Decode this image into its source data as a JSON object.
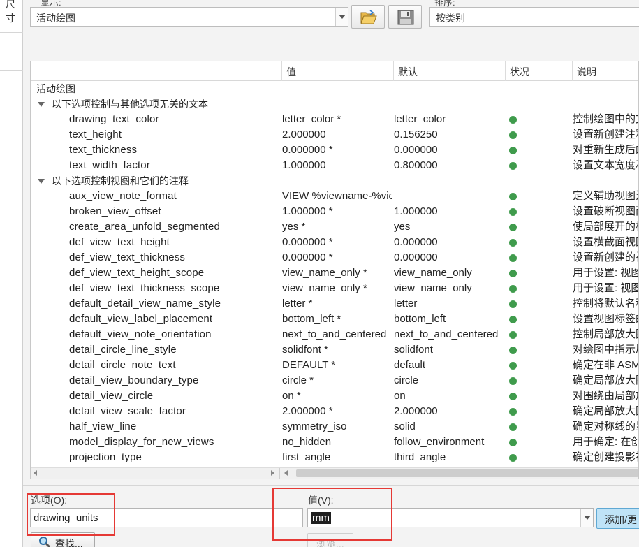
{
  "left_panel": {
    "label": "尺寸"
  },
  "header": {
    "show_label": "显示:",
    "show_value": "活动绘图",
    "sort_label": "排序:",
    "sort_value": "按类别",
    "open_icon": "folder-open-icon",
    "save_icon": "floppy-disk-icon"
  },
  "table": {
    "columns": [
      "",
      "值",
      "默认",
      "状况",
      "说明"
    ],
    "status_color": "#3f9b4c",
    "root_label": "活动绘图",
    "groups": [
      {
        "title": "以下选项控制与其他选项无关的文本",
        "rows": [
          {
            "name": "drawing_text_color",
            "value": "letter_color *",
            "default": "letter_color",
            "desc": "控制绘图中的文"
          },
          {
            "name": "text_height",
            "value": "2.000000",
            "default": "0.156250",
            "desc": "设置新创建注释"
          },
          {
            "name": "text_thickness",
            "value": "0.000000 *",
            "default": "0.000000",
            "desc": "对重新生成后的"
          },
          {
            "name": "text_width_factor",
            "value": "1.000000",
            "default": "0.800000",
            "desc": "设置文本宽度和"
          }
        ]
      },
      {
        "title": "以下选项控制视图和它们的注释",
        "rows": [
          {
            "name": "aux_view_note_format",
            "value": "VIEW %viewname-%viewname",
            "default": "",
            "desc": "定义辅助视图注"
          },
          {
            "name": "broken_view_offset",
            "value": "1.000000 *",
            "default": "1.000000",
            "desc": "设置破断视图两"
          },
          {
            "name": "create_area_unfold_segmented",
            "value": "yes *",
            "default": "yes",
            "desc": "使局部展开的横"
          },
          {
            "name": "def_view_text_height",
            "value": "0.000000 *",
            "default": "0.000000",
            "desc": "设置横截面视图"
          },
          {
            "name": "def_view_text_thickness",
            "value": "0.000000 *",
            "default": "0.000000",
            "desc": "设置新创建的视"
          },
          {
            "name": "def_view_text_height_scope",
            "value": "view_name_only *",
            "default": "view_name_only",
            "desc": "用于设置: 视图"
          },
          {
            "name": "def_view_text_thickness_scope",
            "value": "view_name_only *",
            "default": "view_name_only",
            "desc": "用于设置: 视图"
          },
          {
            "name": "default_detail_view_name_style",
            "value": "letter *",
            "default": "letter",
            "desc": "控制将默认名称"
          },
          {
            "name": "default_view_label_placement",
            "value": "bottom_left *",
            "default": "bottom_left",
            "desc": "设置视图标签的"
          },
          {
            "name": "default_view_note_orientation",
            "value": "next_to_and_centered",
            "default": "next_to_and_centered",
            "desc": "控制局部放大图"
          },
          {
            "name": "detail_circle_line_style",
            "value": "solidfont *",
            "default": "solidfont",
            "desc": "对绘图中指示局"
          },
          {
            "name": "detail_circle_note_text",
            "value": "DEFAULT *",
            "default": "default",
            "desc": "确定在非 ASME"
          },
          {
            "name": "detail_view_boundary_type",
            "value": "circle *",
            "default": "circle",
            "desc": "确定局部放大图"
          },
          {
            "name": "detail_view_circle",
            "value": "on *",
            "default": "on",
            "desc": "对围绕由局部放"
          },
          {
            "name": "detail_view_scale_factor",
            "value": "2.000000 *",
            "default": "2.000000",
            "desc": "确定局部放大图"
          },
          {
            "name": "half_view_line",
            "value": "symmetry_iso",
            "default": "solid",
            "desc": "确定对称线的显"
          },
          {
            "name": "model_display_for_new_views",
            "value": "no_hidden",
            "default": "follow_environment",
            "desc": "用于确定: 在创"
          },
          {
            "name": "projection_type",
            "value": "first_angle",
            "default": "third_angle",
            "desc": "确定创建投影视"
          }
        ]
      }
    ]
  },
  "form": {
    "option_label": "选项(O):",
    "option_value": "drawing_units",
    "value_label": "值(V):",
    "value_value": "mm",
    "add_button": "添加/更",
    "find_button": "查找...",
    "browse_button": "浏览...",
    "highlight_color": "#e53935"
  }
}
